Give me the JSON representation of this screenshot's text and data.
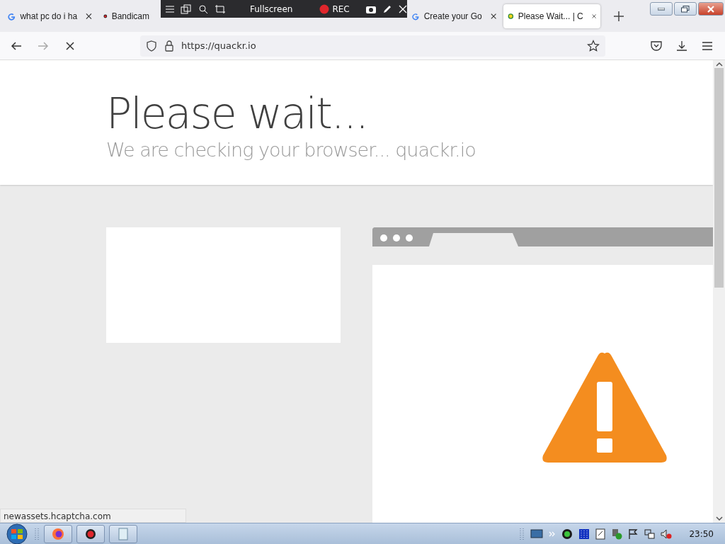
{
  "tabs": [
    {
      "label": "what pc do i ha",
      "kind": "google",
      "selected": false,
      "closable": true
    },
    {
      "label": "Bandicam",
      "kind": "record",
      "selected": false,
      "closable": false
    },
    {
      "label": "Create your Go",
      "kind": "google",
      "selected": false,
      "closable": true
    },
    {
      "label": "Please Wait... | C",
      "kind": "quackr",
      "selected": true,
      "closable": true
    }
  ],
  "recorder_bar": {
    "mode": "Fullscreen",
    "record": "REC"
  },
  "address_bar": {
    "url": "https://quackr.io"
  },
  "page": {
    "title": "Please wait...",
    "subtitle": "We are checking your browser... quackr.io"
  },
  "status_text": "newassets.hcaptcha.com",
  "taskbar": {
    "clock": "23:50"
  }
}
